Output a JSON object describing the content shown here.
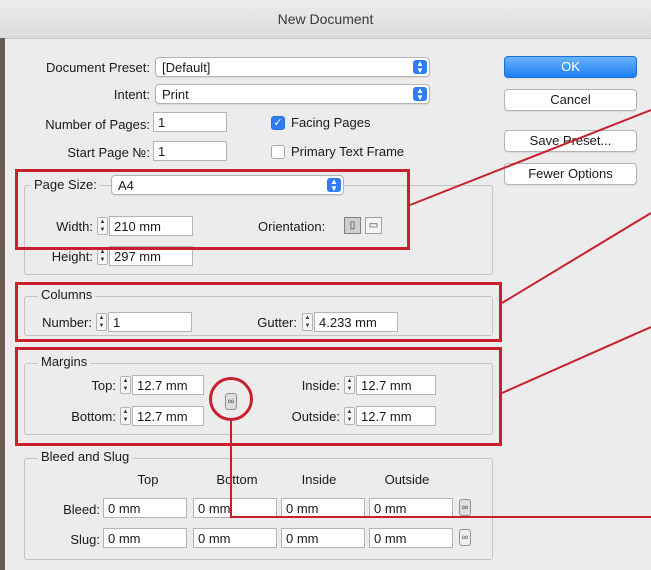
{
  "window": {
    "title": "New Document"
  },
  "document": {
    "preset_label": "Document Preset:",
    "preset_value": "[Default]",
    "intent_label": "Intent:",
    "intent_value": "Print",
    "pages_label": "Number of Pages:",
    "pages_value": "1",
    "start_label": "Start Page №:",
    "start_value": "1",
    "facing_pages_label": "Facing Pages",
    "facing_pages_checked": true,
    "primary_frame_label": "Primary Text Frame",
    "primary_frame_checked": false
  },
  "buttons": {
    "ok": "OK",
    "cancel": "Cancel",
    "save_preset": "Save Preset...",
    "fewer_options": "Fewer Options"
  },
  "page_size": {
    "label": "Page Size:",
    "value": "A4",
    "width_label": "Width:",
    "width_value": "210 mm",
    "height_label": "Height:",
    "height_value": "297 mm",
    "orientation_label": "Orientation:",
    "orientation_selected": "portrait"
  },
  "columns": {
    "title": "Columns",
    "number_label": "Number:",
    "number_value": "1",
    "gutter_label": "Gutter:",
    "gutter_value": "4.233 mm"
  },
  "margins": {
    "title": "Margins",
    "top_label": "Top:",
    "top_value": "12.7 mm",
    "bottom_label": "Bottom:",
    "bottom_value": "12.7 mm",
    "inside_label": "Inside:",
    "inside_value": "12.7 mm",
    "outside_label": "Outside:",
    "outside_value": "12.7 mm",
    "link_icon": "chain-link-icon"
  },
  "bleed_slug": {
    "title": "Bleed and Slug",
    "headers": [
      "Top",
      "Bottom",
      "Inside",
      "Outside"
    ],
    "bleed_label": "Bleed:",
    "bleed_values": [
      "0 mm",
      "0 mm",
      "0 mm",
      "0 mm"
    ],
    "slug_label": "Slug:",
    "slug_values": [
      "0 mm",
      "0 mm",
      "0 mm",
      "0 mm"
    ]
  },
  "colors": {
    "highlight": "#c8202d",
    "accent": "#2e7cf6"
  }
}
